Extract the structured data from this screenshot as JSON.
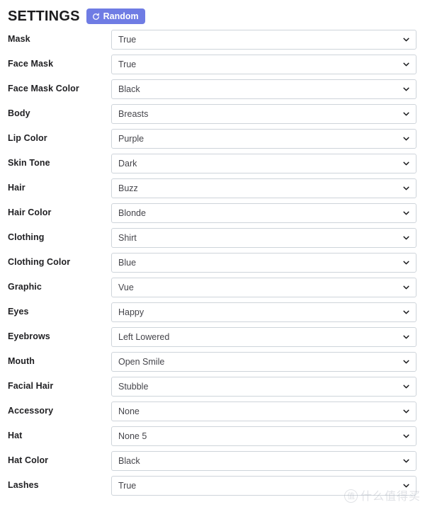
{
  "header": {
    "title": "SETTINGS",
    "random_button_label": "Random",
    "random_button_icon": "refresh-icon",
    "random_button_color": "#6f7ce4"
  },
  "form": {
    "rows": [
      {
        "label": "Mask",
        "value": "True"
      },
      {
        "label": "Face Mask",
        "value": "True"
      },
      {
        "label": "Face Mask Color",
        "value": "Black"
      },
      {
        "label": "Body",
        "value": "Breasts"
      },
      {
        "label": "Lip Color",
        "value": "Purple"
      },
      {
        "label": "Skin Tone",
        "value": "Dark"
      },
      {
        "label": "Hair",
        "value": "Buzz"
      },
      {
        "label": "Hair Color",
        "value": "Blonde"
      },
      {
        "label": "Clothing",
        "value": "Shirt"
      },
      {
        "label": "Clothing Color",
        "value": "Blue"
      },
      {
        "label": "Graphic",
        "value": "Vue"
      },
      {
        "label": "Eyes",
        "value": "Happy"
      },
      {
        "label": "Eyebrows",
        "value": "Left Lowered"
      },
      {
        "label": "Mouth",
        "value": "Open Smile"
      },
      {
        "label": "Facial Hair",
        "value": "Stubble"
      },
      {
        "label": "Accessory",
        "value": "None"
      },
      {
        "label": "Hat",
        "value": "None 5"
      },
      {
        "label": "Hat Color",
        "value": "Black"
      },
      {
        "label": "Lashes",
        "value": "True"
      }
    ],
    "dropdown_icon": "chevron-down-icon",
    "border_color": "#ced4da"
  },
  "watermark": {
    "mark": "值",
    "text": "什么值得买"
  }
}
